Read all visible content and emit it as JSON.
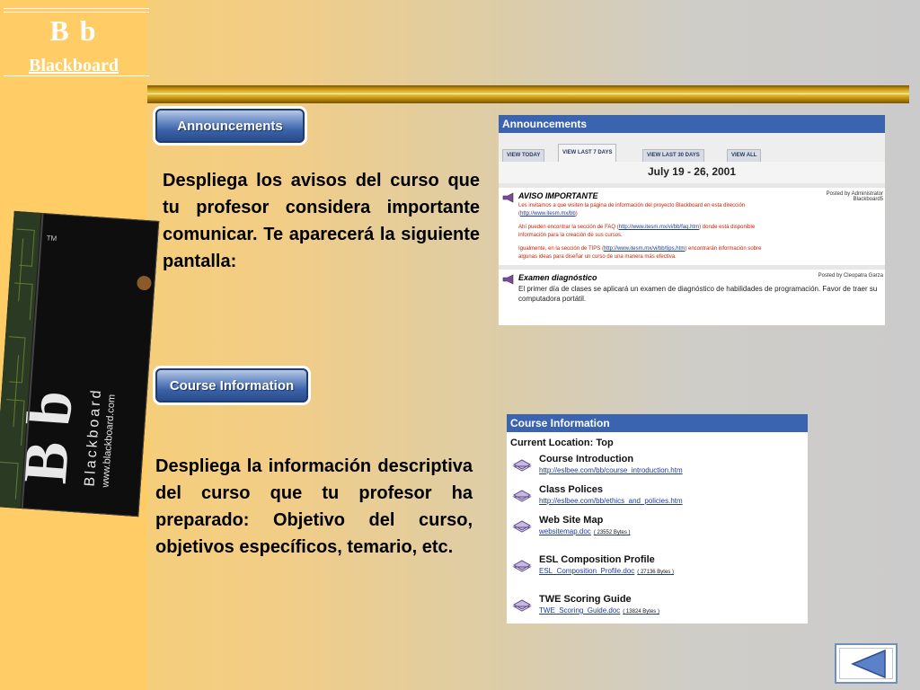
{
  "sidebar": {
    "logo_text": "B b",
    "brand_name": "Blackboard",
    "book_logo": "B b",
    "book_word": "Blackboard",
    "book_url": "www.blackboard.com",
    "book_tm": "TM"
  },
  "sections": {
    "announcements": {
      "button_label": "Announcements",
      "description": "Despliega los avisos del curso que tu profesor considera importante comunicar. Te aparecerá la siguiente pantalla:"
    },
    "course_information": {
      "button_label": "Course Information",
      "description": "Despliega la información descriptiva del curso que tu profesor ha preparado: Objetivo del curso, objetivos específicos, temario, etc."
    }
  },
  "announcements_screen": {
    "header": "Announcements",
    "tabs": [
      {
        "label": "VIEW TODAY"
      },
      {
        "label": "VIEW LAST 7 DAYS"
      },
      {
        "label": "VIEW LAST 30 DAYS"
      },
      {
        "label": "VIEW ALL"
      }
    ],
    "date_range": "July 19 - 26, 2001",
    "items": [
      {
        "title": "AVISO IMPORTANTE",
        "posted": "Posted by Administrator Blackboard5",
        "p1": "Les invitamos a que visiten la página de información del proyecto Blackboard en esta dirección (",
        "p1_link": "http://www.itesm.mx/bb",
        "p1_end": ")",
        "p2": "Ahí pueden encontrar la sección de FAQ (",
        "p2_link": "http://www.itesm.mx/vi/bb/faq.htm",
        "p2_end": ") donde está disponible información para la creación de sus cursos.",
        "p3": "Igualmente, en la sección de TIPS (",
        "p3_link": "http://www.itesm.mx/vi/bb/tips.htm",
        "p3_end": ") encontrarán información sobre algunas ideas para diseñar un curso de una manera más efectiva."
      },
      {
        "title": "Examen diagnóstico",
        "posted": "Posted by Cleopatra Garza",
        "body": "El primer día de clases se aplicará un examen de diagnóstico de habilidades de programación. Favor de traer su computadora portátil."
      }
    ]
  },
  "course_info_screen": {
    "header": "Course Information",
    "location": "Current Location: Top",
    "items": [
      {
        "title": "Course Introduction",
        "link": "http://eslbee.com/bb/course_introduction.htm",
        "size": ""
      },
      {
        "title": "Class Polices",
        "link": "http://eslbee.com/bb/ethics_and_policies.htm",
        "size": ""
      },
      {
        "title": "Web Site Map",
        "link": "websitemap.doc",
        "size": "( 23552 Bytes )"
      },
      {
        "title": "ESL Composition Profile",
        "link": "ESL_Composition_Profile.doc",
        "size": "( 27136 Bytes )"
      },
      {
        "title": "TWE Scoring Guide",
        "link": "TWE_Scoring_Guide.doc",
        "size": "( 13824 Bytes )"
      }
    ]
  },
  "navigation": {
    "back_icon": "triangle-left-icon"
  },
  "colors": {
    "sidebar": "#ffcc66",
    "panel_header": "#3a64b0",
    "button_blue": "#3a62a8",
    "gold": "#c99612"
  }
}
